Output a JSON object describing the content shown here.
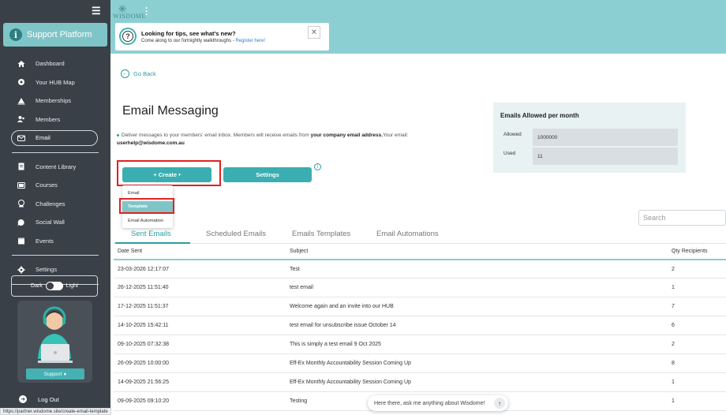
{
  "sidebar": {
    "brand": "Support Platform",
    "items": [
      {
        "label": "Dashboard",
        "icon": "home-icon"
      },
      {
        "label": "Your HUB Map",
        "icon": "hub-map-icon"
      },
      {
        "label": "Memberships",
        "icon": "memberships-icon"
      },
      {
        "label": "Members",
        "icon": "members-icon"
      },
      {
        "label": "Email",
        "icon": "email-icon"
      },
      {
        "label": "Content Library",
        "icon": "content-library-icon"
      },
      {
        "label": "Courses",
        "icon": "courses-icon"
      },
      {
        "label": "Challenges",
        "icon": "challenges-icon"
      },
      {
        "label": "Social Wall",
        "icon": "social-wall-icon"
      },
      {
        "label": "Events",
        "icon": "events-icon"
      },
      {
        "label": "Settings",
        "icon": "gear-icon"
      }
    ],
    "theme": {
      "dark": "Dark",
      "light": "Light"
    },
    "support_label": "Support",
    "logout_label": "Log Out"
  },
  "header": {
    "logo_text": "WISDOME",
    "tip_title": "Looking for tips, see what's new?",
    "tip_body": "Come along to our fortnightly walkthroughs - ",
    "tip_link": "Register here!"
  },
  "main": {
    "go_back": "Go Back",
    "title": "Email Messaging",
    "desc_1": "Deliver messages to your members' email inbox. Members will receive emails from ",
    "desc_bold": "your company email address.",
    "desc_2": "Your email: ",
    "desc_email": "userhelp@wisdome.com.au",
    "create_label": "+ Create",
    "settings_label": "Settings",
    "dropdown": [
      "Email",
      "Template",
      "Email Automation"
    ],
    "search_placeholder": "Search",
    "tabs": [
      "Sent Emails",
      "Scheduled Emails",
      "Emails Templates",
      "Email Automations"
    ],
    "quota": {
      "title": "Emails Allowed per month",
      "allowed_label": "Allowed",
      "allowed_value": "1000000",
      "used_label": "Used",
      "used_value": "11"
    }
  },
  "table": {
    "headers": [
      "Date Sent",
      "Subject",
      "Qty Recipients"
    ],
    "rows": [
      [
        "23-03-2026 12:17:07",
        "Test",
        "2"
      ],
      [
        "26-12-2025 11:51:40",
        "test email",
        "1"
      ],
      [
        "17-12-2025 11:51:37",
        "Welcome again and an invite into our HUB",
        "7"
      ],
      [
        "14-10-2025 15:42:11",
        "test email for unsubscribe issue October 14",
        "6"
      ],
      [
        "09-10-2025 07:32:38",
        "This is simply a test email 9 Oct 2025",
        "2"
      ],
      [
        "26-09-2025 10:00:00",
        "Eff-Ex Monthly Accountability Session Coming Up",
        "8"
      ],
      [
        "14-09-2025 21:56:25",
        "Eff-Ex Monthly Accountability Session Coming Up",
        "1"
      ],
      [
        "09-09-2025 09:10:20",
        "Testing",
        "1"
      ]
    ]
  },
  "chat": {
    "placeholder": "Here there, ask me anything about Wisdome!"
  },
  "status_url": "https://partner.wisdome.site/create-email-template",
  "colors": {
    "accent": "#3aaeb1",
    "sidebar": "#3a4047",
    "highlight": "#e02121",
    "band": "#8ccfd3"
  }
}
